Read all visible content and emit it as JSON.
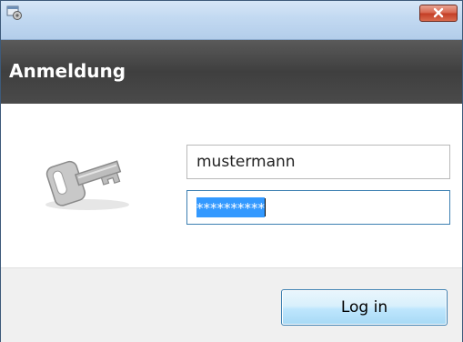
{
  "window": {
    "close_icon": "close-x-icon",
    "app_icon": "app-window-icon"
  },
  "header": {
    "title": "Anmeldung"
  },
  "form": {
    "key_icon": "key-icon",
    "username_value": "mustermann",
    "password_value": "**********"
  },
  "footer": {
    "login_label": "Log in"
  },
  "colors": {
    "header_bg": "#454545",
    "selection": "#3399ff",
    "close_button": "#c9452b",
    "footer_bg": "#f0f0f0"
  }
}
